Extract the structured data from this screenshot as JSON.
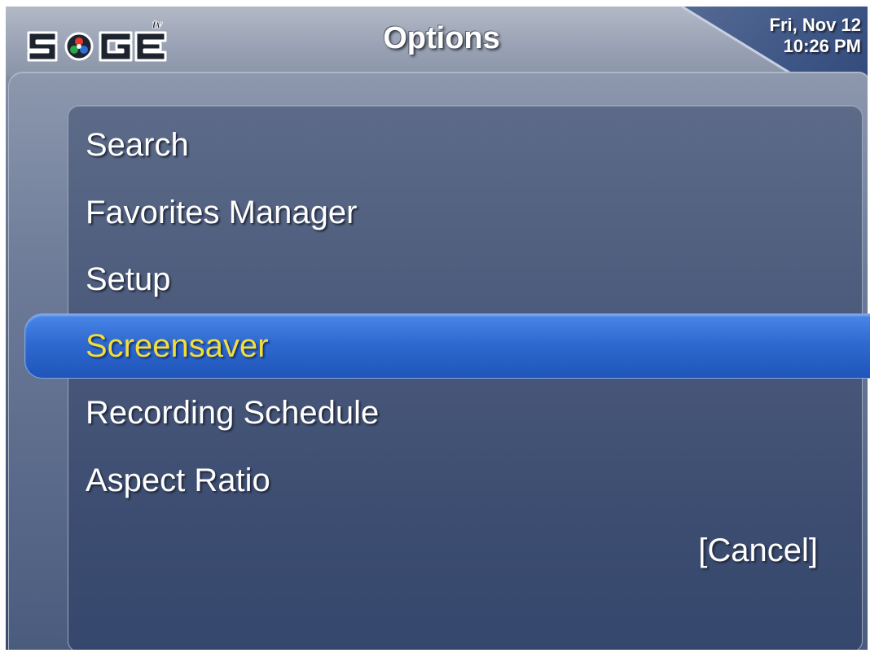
{
  "header": {
    "logo_text": "SAGE tv",
    "title": "Options",
    "clock": {
      "date": "Fri, Nov 12",
      "time": "10:26 PM"
    }
  },
  "menu": {
    "items": [
      {
        "label": "Search"
      },
      {
        "label": "Favorites Manager"
      },
      {
        "label": "Setup"
      },
      {
        "label": "Screensaver",
        "selected": true
      },
      {
        "label": "Recording Schedule"
      },
      {
        "label": "Aspect Ratio"
      }
    ],
    "cancel_label": "[Cancel]"
  },
  "colors": {
    "selection_bar": "#2f6ad0",
    "selected_text": "#f3dd3c",
    "panel": "#4b5a7b",
    "text": "#ffffff"
  }
}
